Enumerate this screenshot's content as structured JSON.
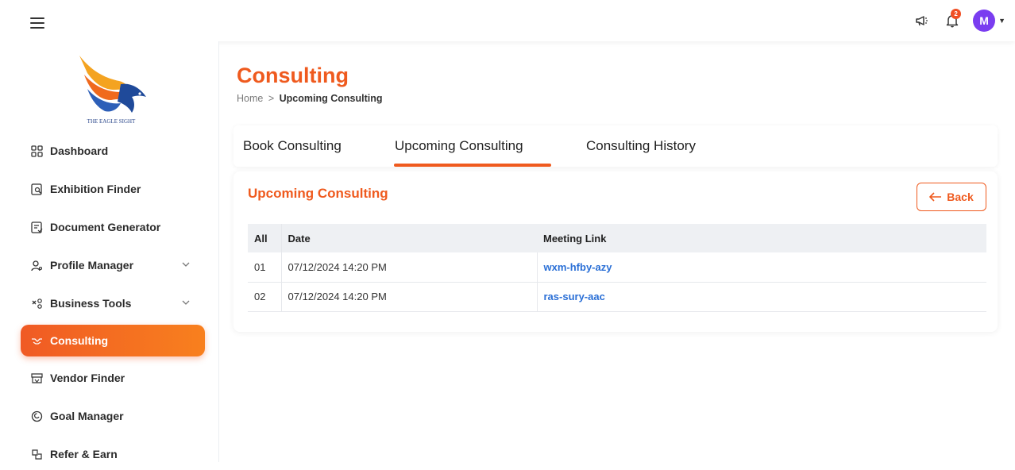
{
  "header": {
    "icons": [
      "menu-icon",
      "megaphone-icon",
      "bell-icon",
      "avatar"
    ],
    "notification_count": "2",
    "avatar_initial": "M"
  },
  "sidebar": {
    "logo_text": "THE EAGLE SIGHT",
    "items": [
      {
        "label": "Dashboard",
        "icon": "dashboard-icon"
      },
      {
        "label": "Exhibition Finder",
        "icon": "exhibition-icon"
      },
      {
        "label": "Document Generator",
        "icon": "document-icon"
      },
      {
        "label": "Profile Manager",
        "icon": "profile-icon",
        "expandable": true
      },
      {
        "label": "Business Tools",
        "icon": "tools-icon",
        "expandable": true
      },
      {
        "label": "Consulting",
        "icon": "handshake-icon",
        "active": true
      },
      {
        "label": "Vendor Finder",
        "icon": "vendor-icon"
      },
      {
        "label": "Goal Manager",
        "icon": "goal-icon"
      },
      {
        "label": "Refer & Earn",
        "icon": "refer-icon"
      }
    ]
  },
  "page": {
    "title": "Consulting",
    "breadcrumb_home": "Home",
    "breadcrumb_sep": ">",
    "breadcrumb_current": "Upcoming Consulting"
  },
  "tabs": [
    {
      "label": "Book Consulting"
    },
    {
      "label": "Upcoming Consulting",
      "active": true
    },
    {
      "label": "Consulting History"
    }
  ],
  "panel": {
    "title": "Upcoming Consulting",
    "back_label": "Back"
  },
  "table": {
    "headers": [
      "All",
      "Date",
      "Meeting Link"
    ],
    "rows": [
      {
        "num": "01",
        "date": "07/12/2024 14:20 PM",
        "link": "wxm-hfby-azy"
      },
      {
        "num": "02",
        "date": "07/12/2024 14:20 PM",
        "link": "ras-sury-aac"
      }
    ]
  },
  "colors": {
    "accent": "#ef5a1e",
    "link": "#2a6fd6",
    "avatar": "#7a3df0"
  }
}
